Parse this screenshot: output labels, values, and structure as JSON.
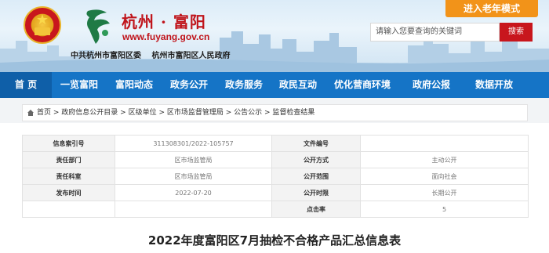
{
  "header": {
    "site_title": "杭州 · 富阳",
    "site_url": "www.fuyang.gov.cn",
    "org_names": [
      "中共杭州市富阳区委",
      "杭州市富阳区人民政府"
    ],
    "elder_mode_label": "进入老年模式",
    "search": {
      "placeholder": "请输入您要查询的关键词",
      "button_label": "搜索"
    }
  },
  "nav": {
    "items": [
      {
        "label": "首 页"
      },
      {
        "label": "一览富阳"
      },
      {
        "label": "富阳动态"
      },
      {
        "label": "政务公开"
      },
      {
        "label": "政务服务"
      },
      {
        "label": "政民互动"
      },
      {
        "label": "优化营商环境"
      },
      {
        "label": "政府公报"
      },
      {
        "label": "数据开放"
      }
    ]
  },
  "breadcrumb": {
    "items": [
      "首页",
      "政府信息公开目录",
      "区级单位",
      "区市场监督管理局",
      "公告公示",
      "监督检查结果"
    ],
    "separator": " > "
  },
  "info": {
    "rows": [
      [
        {
          "label": "信息索引号"
        },
        {
          "value": "311308301/2022-105757"
        },
        {
          "label": "文件编号"
        },
        {
          "value": ""
        }
      ],
      [
        {
          "label": "责任部门"
        },
        {
          "value": "区市场监管局"
        },
        {
          "label": "公开方式"
        },
        {
          "value": "主动公开"
        }
      ],
      [
        {
          "label": "责任科室"
        },
        {
          "value": "区市场监管局"
        },
        {
          "label": "公开范围"
        },
        {
          "value": "面向社会"
        }
      ],
      [
        {
          "label": "发布时间"
        },
        {
          "value": "2022-07-20"
        },
        {
          "label": "公开时限"
        },
        {
          "value": "长期公开"
        }
      ],
      [
        {
          "label": ""
        },
        {
          "value": ""
        },
        {
          "label": "点击率"
        },
        {
          "value": "5"
        }
      ]
    ]
  },
  "document": {
    "title": "2022年度富阳区7月抽检不合格产品汇总信息表"
  },
  "colors": {
    "brand_red": "#c8161d",
    "nav_blue": "#1574c6",
    "elder_orange": "#f29319"
  }
}
